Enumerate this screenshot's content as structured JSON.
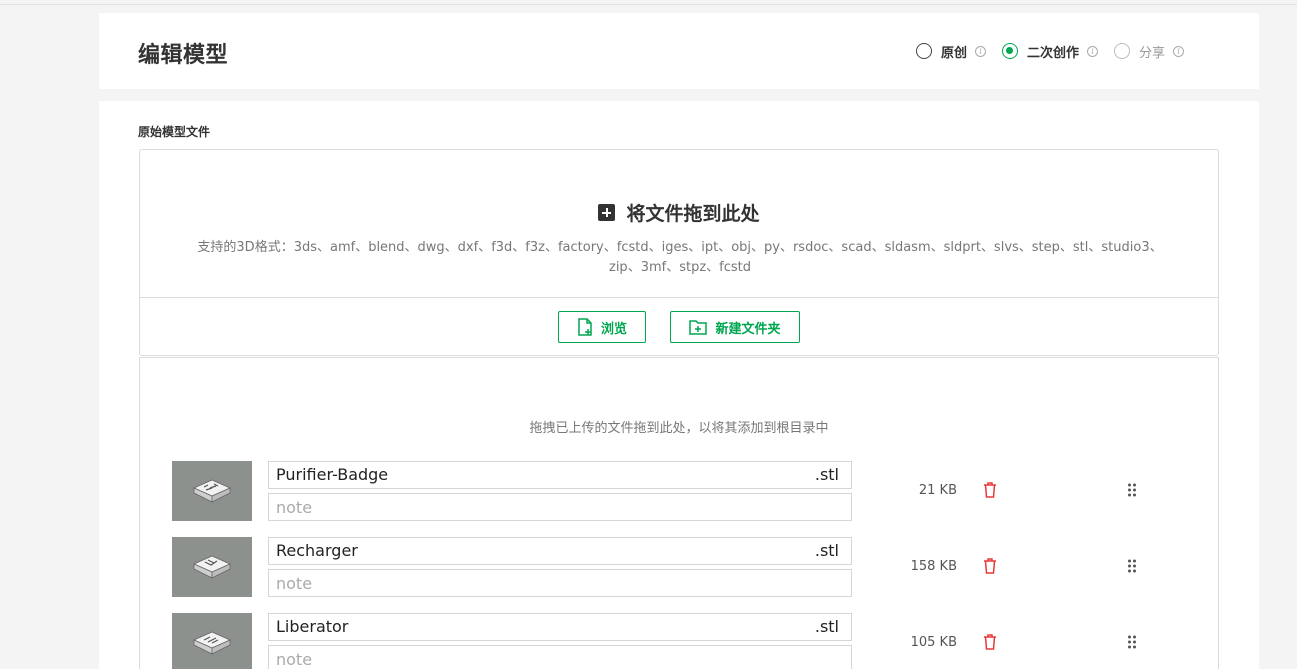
{
  "header": {
    "title": "编辑模型",
    "options": [
      {
        "label": "原创",
        "state": "unchecked"
      },
      {
        "label": "二次创作",
        "state": "checked"
      },
      {
        "label": "分享",
        "state": "muted"
      }
    ]
  },
  "upload": {
    "section_label": "原始模型文件",
    "drop_title": "将文件拖到此处",
    "formats_line1": "支持的3D格式：3ds、amf、blend、dwg、dxf、f3d、f3z、factory、fcstd、iges、ipt、obj、py、rsdoc、scad、sldasm、sldprt、slvs、step、stl、studio3、",
    "formats_line2": "zip、3mf、stpz、fcstd",
    "browse_label": "浏览",
    "new_folder_label": "新建文件夹"
  },
  "files": {
    "hint": "拖拽已上传的文件拖到此处，以将其添加到根目录中",
    "note_placeholder": "note",
    "items": [
      {
        "name": "Purifier-Badge",
        "ext": ".stl",
        "size": "21 KB"
      },
      {
        "name": "Recharger",
        "ext": ".stl",
        "size": "158 KB"
      },
      {
        "name": "Liberator",
        "ext": ".stl",
        "size": "105 KB"
      }
    ]
  },
  "colors": {
    "accent": "#00a650",
    "danger": "#e53935",
    "thumb_bg": "#8c918e"
  }
}
